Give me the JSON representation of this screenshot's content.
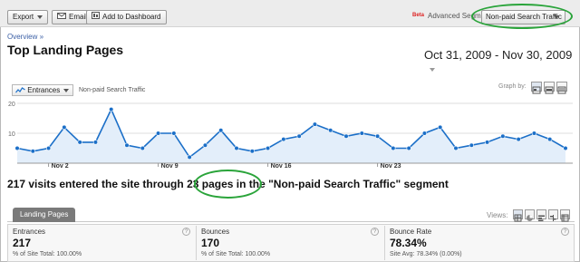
{
  "toolbar": {
    "export_label": "Export",
    "email_label": "Email",
    "dashboard_label": "Add to Dashboard",
    "beta_label": "Beta",
    "advanced_segments_label": "Advanced Segments:",
    "segment_selected": "Non-paid Search Traffic"
  },
  "breadcrumb": "Overview »",
  "page_title": "Top Landing Pages",
  "date_range": "Oct 31, 2009 - Nov 30, 2009",
  "graph": {
    "metric_label": "Entrances",
    "segment_label": "Non-paid Search Traffic",
    "graph_by_label": "Graph by:"
  },
  "chart_data": {
    "type": "area",
    "title": "",
    "series": [
      {
        "name": "Non-paid Search Traffic",
        "values": [
          5,
          4,
          5,
          12,
          7,
          7,
          18,
          6,
          5,
          10,
          10,
          2,
          6,
          11,
          5,
          4,
          5,
          8,
          9,
          13,
          11,
          9,
          10,
          9,
          5,
          5,
          10,
          12,
          5,
          6,
          7,
          9,
          8,
          10,
          8,
          5
        ]
      }
    ],
    "x_tick_labels": [
      "Nov 2",
      "Nov 9",
      "Nov 16",
      "Nov 23"
    ],
    "x_tick_indices": [
      2,
      9,
      16,
      23
    ],
    "y_tick_labels": [
      "10",
      "20"
    ],
    "ylim": [
      0,
      20
    ],
    "grid": true,
    "colors": {
      "line": "#1b6fc8",
      "fill": "#e3eefa",
      "grid": "#dddddd"
    }
  },
  "summary": {
    "prefix": "217 visits entered the site through ",
    "pages": "23 pages",
    "suffix": " in the \"Non-paid Search Traffic\" segment"
  },
  "table_tab": "Landing Pages",
  "views_label": "Views:",
  "stats": [
    {
      "label": "Entrances",
      "value": "217",
      "sub": "% of Site Total: 100.00%"
    },
    {
      "label": "Bounces",
      "value": "170",
      "sub": "% of Site Total: 100.00%"
    },
    {
      "label": "Bounce Rate",
      "value": "78.34%",
      "sub": "Site Avg: 78.34% (0.00%)"
    }
  ],
  "help_glyph": "?"
}
